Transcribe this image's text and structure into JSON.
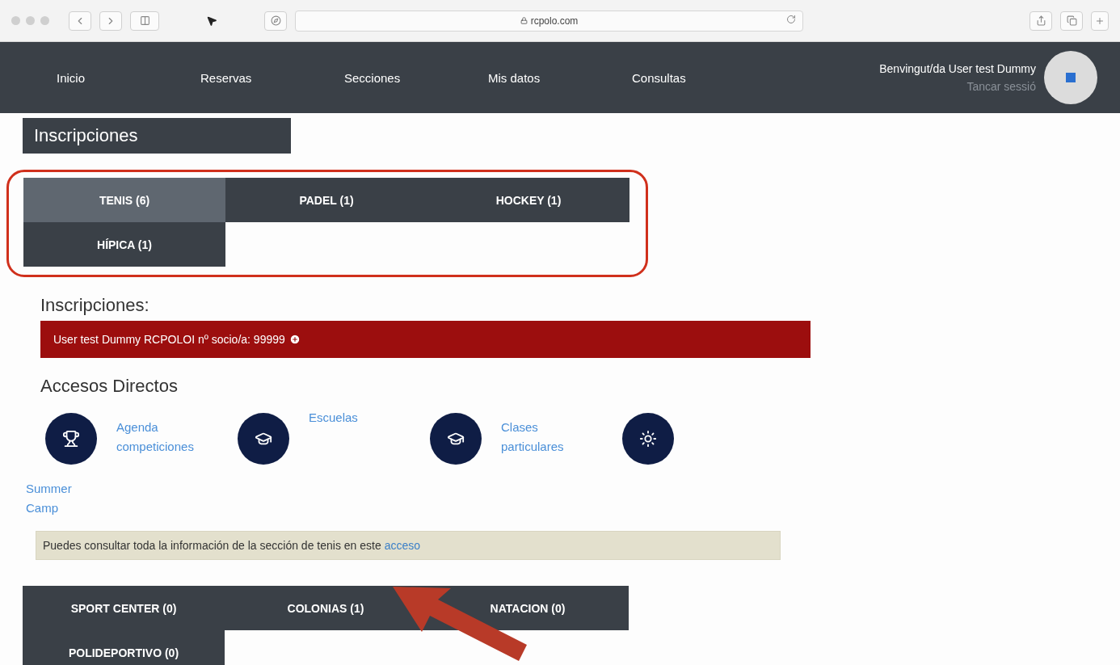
{
  "browser": {
    "address": "rcpolo.com"
  },
  "nav": {
    "items": [
      {
        "label": "Inicio"
      },
      {
        "label": "Reservas"
      },
      {
        "label": "Secciones"
      },
      {
        "label": "Mis datos"
      },
      {
        "label": "Consultas"
      }
    ],
    "greeting": "Benvingut/da User test Dummy",
    "logout": "Tancar sessió"
  },
  "page_title": "Inscripciones",
  "tabs": [
    {
      "label": "TENIS (6)",
      "selected": true
    },
    {
      "label": "PADEL (1)",
      "selected": false
    },
    {
      "label": "HOCKEY (1)",
      "selected": false
    },
    {
      "label": "HÍPICA (1)",
      "selected": false
    }
  ],
  "section_title": "Inscripciones:",
  "member_bar": {
    "text": "User test Dummy RCPOLOI nº socio/a: 99999"
  },
  "shortcuts": {
    "title": "Accesos Directos",
    "items": [
      {
        "kind": "trophy",
        "label": "Agenda competiciones"
      },
      {
        "kind": "graduation",
        "label": "Escuelas"
      },
      {
        "kind": "graduation",
        "label": "Clases particulares"
      },
      {
        "kind": "sun"
      },
      {
        "label": "Summer Camp"
      }
    ]
  },
  "info": {
    "text": "Puedes consultar toda la información de la sección de tenis en este",
    "link": "acceso"
  },
  "other_tabs": [
    {
      "label": "SPORT CENTER (0)",
      "selected": false
    },
    {
      "label": "COLONIAS (1)",
      "selected": false
    },
    {
      "label": "NATACION (0)",
      "selected": false
    },
    {
      "label": "POLIDEPORTIVO (0)",
      "selected": false
    }
  ]
}
